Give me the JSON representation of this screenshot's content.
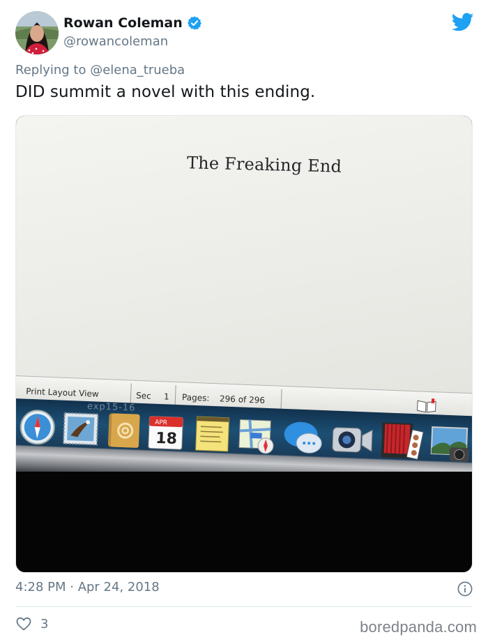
{
  "tweet": {
    "display_name": "Rowan Coleman",
    "handle": "@rowancoleman",
    "replying_prefix": "Replying to",
    "replying_handle": "@elena_trueba",
    "text": "DID summit a novel with this ending.",
    "timestamp": "4:28 PM · Apr 24, 2018",
    "like_count": "3",
    "verified": true,
    "brand_color": "#1da1f2"
  },
  "photo": {
    "document_text": "The Freaking End",
    "status_bar": {
      "view_label": "Print Layout View",
      "sec_label": "Sec",
      "sec_value": "1",
      "pages_label": "Pages:",
      "pages_value": "296 of 296"
    },
    "dock_folder_label": "exp15-16",
    "calendar": {
      "month": "APR",
      "day": "18"
    },
    "dock_icons": [
      "safari-icon",
      "mail-icon",
      "contacts-icon",
      "calendar-icon",
      "notes-icon",
      "maps-icon",
      "messages-icon",
      "facetime-icon",
      "photo-booth-icon",
      "image-capture-icon"
    ]
  },
  "watermark": "boredpanda.com"
}
